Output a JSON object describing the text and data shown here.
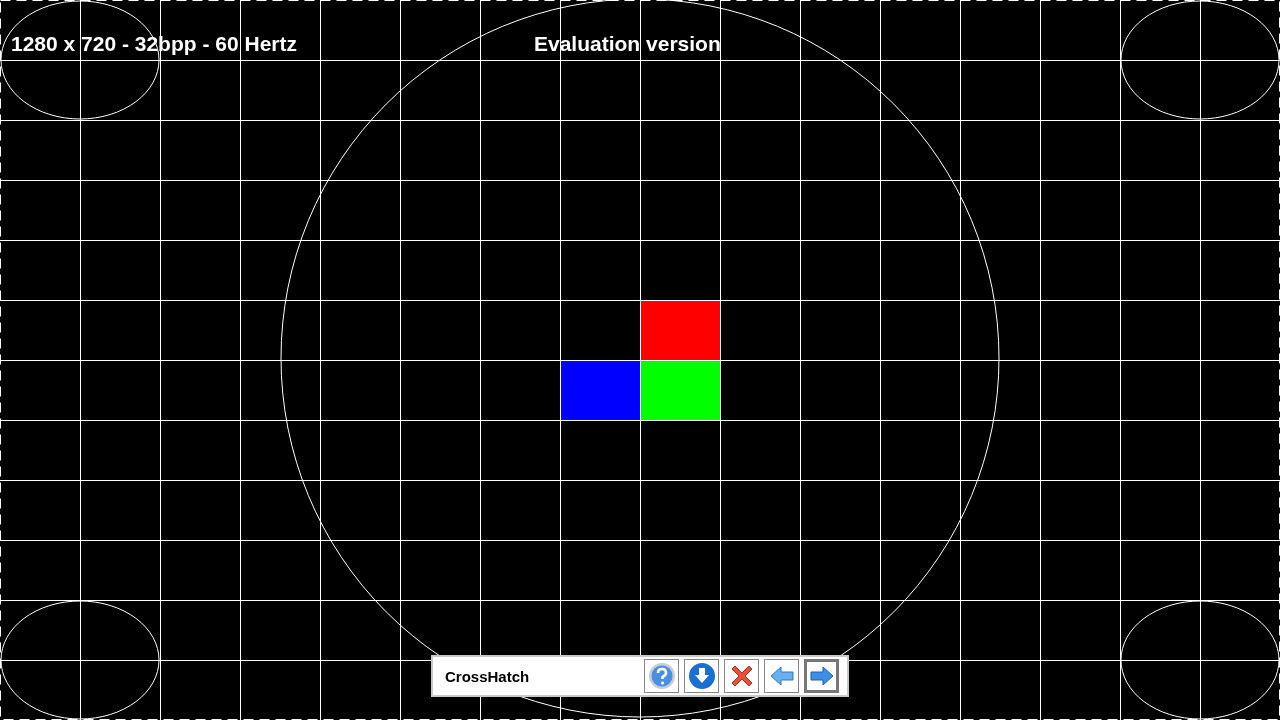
{
  "info_text": "1280 x 720 - 32bpp - 60 Hertz",
  "notice": "Evaluation version",
  "toolbar": {
    "pattern_name": "CrossHatch",
    "buttons": [
      {
        "kind": "help",
        "selected": false
      },
      {
        "kind": "down",
        "selected": false
      },
      {
        "kind": "close",
        "selected": false
      },
      {
        "kind": "previous",
        "selected": false
      },
      {
        "kind": "next",
        "selected": true
      }
    ]
  }
}
